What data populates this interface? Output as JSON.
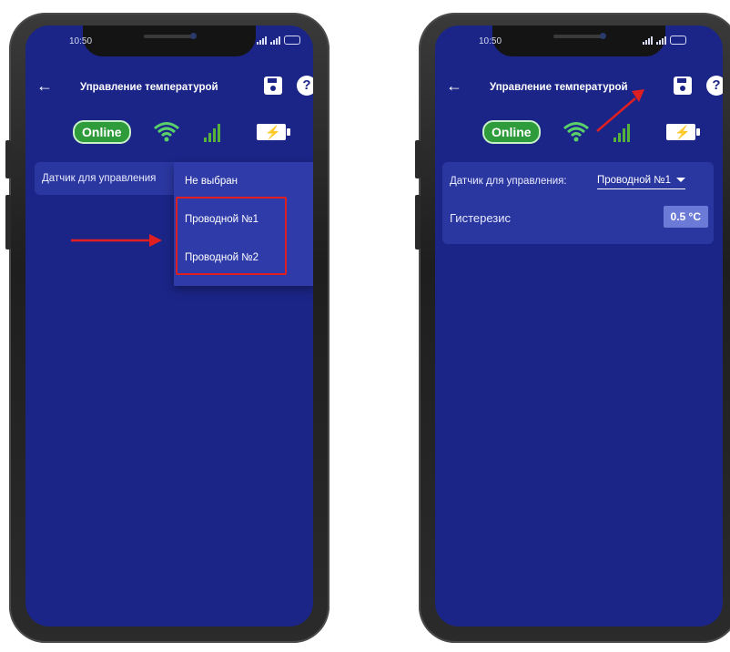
{
  "phones": [
    {
      "time": "10:50",
      "title": "Управление температурой",
      "online_label": "Online",
      "sensor_label": "Датчик для управления",
      "dropdown_options": [
        "Не выбран",
        "Проводной №1",
        "Проводной №2"
      ]
    },
    {
      "time": "10:50",
      "title": "Управление температурой",
      "online_label": "Online",
      "sensor_label": "Датчик для управления:",
      "selected_sensor": "Проводной №1",
      "hysteresis_label": "Гистерезис",
      "hysteresis_value": "0.5 °C"
    }
  ],
  "colors": {
    "screen_bg": "#1b2587",
    "card_bg": "#2b37a0",
    "online_green": "#2e9c3a",
    "annotation_red": "#e02020"
  },
  "icons": [
    "back-arrow-icon",
    "save-icon",
    "help-icon",
    "wifi-icon",
    "cellular-signal-icon",
    "battery-charging-icon"
  ]
}
